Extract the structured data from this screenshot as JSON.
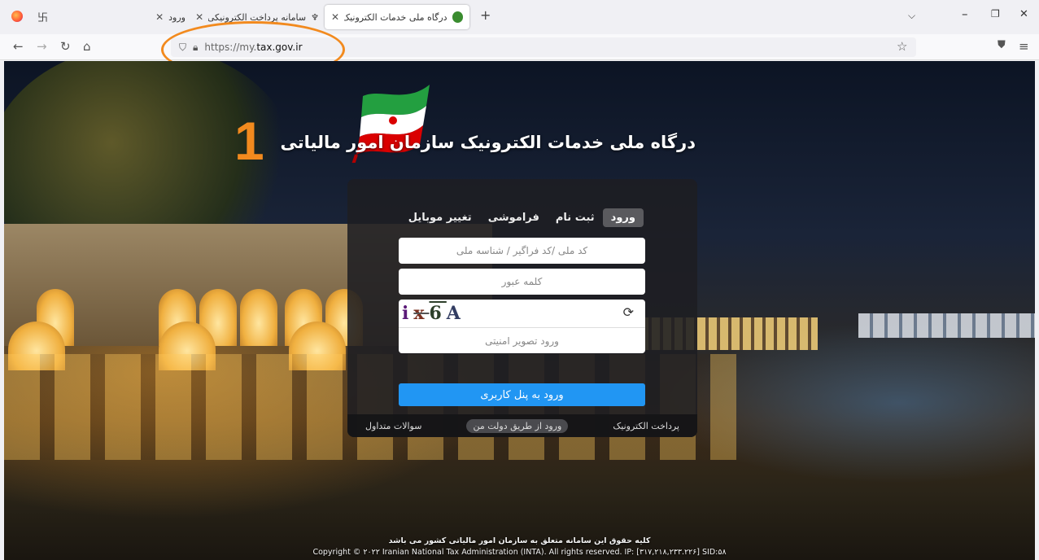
{
  "browser": {
    "tabs": [
      {
        "title": "ورود"
      },
      {
        "title": "سامانه پرداخت الکترونیکی تعرفه"
      },
      {
        "title": "درگاه ملی خدمات الکترونیک سازمان امور مالیاتی"
      }
    ],
    "new_tab_label": "+",
    "url_prefix": "https://my.",
    "url_host": "tax.gov.ir"
  },
  "annotation": {
    "step_number": "1",
    "color": "#f28a1e"
  },
  "page": {
    "title": "درگاه ملی خدمات الکترونیک سازمان امور مالیاتی",
    "tabs": {
      "login": "ورود",
      "register": "ثبت نام",
      "forgot": "فراموشی",
      "change_mobile": "تغییر موبایل"
    },
    "national_id_placeholder": "کد ملی /کد فراگیر / شناسه ملی",
    "password_placeholder": "کلمه عبور",
    "captcha": {
      "chars": [
        "i",
        "x",
        "6",
        "A"
      ],
      "placeholder": "ورود تصویر امنیتی"
    },
    "login_button": "ورود به پنل کاربری",
    "footer_links": {
      "epayment": "پرداخت الکترونیک",
      "dolat_login": "ورود از طریق دولت من",
      "faq": "سوالات متداول"
    },
    "copyright_fa": "کلیه حقوق این سامانه متعلق به سازمان امور مالیاتی کشور می باشد",
    "copyright_en": "Copyright © ۲۰۲۲ Iranian National Tax Administration (INTA). All rights reserved. IP: [۳۱۷,۲۱۸,۲۳۳.۲۲۶] SID:۵۸"
  },
  "colors": {
    "accent_button": "#2196f3",
    "flag_green": "#239f40",
    "flag_red": "#da0000"
  }
}
